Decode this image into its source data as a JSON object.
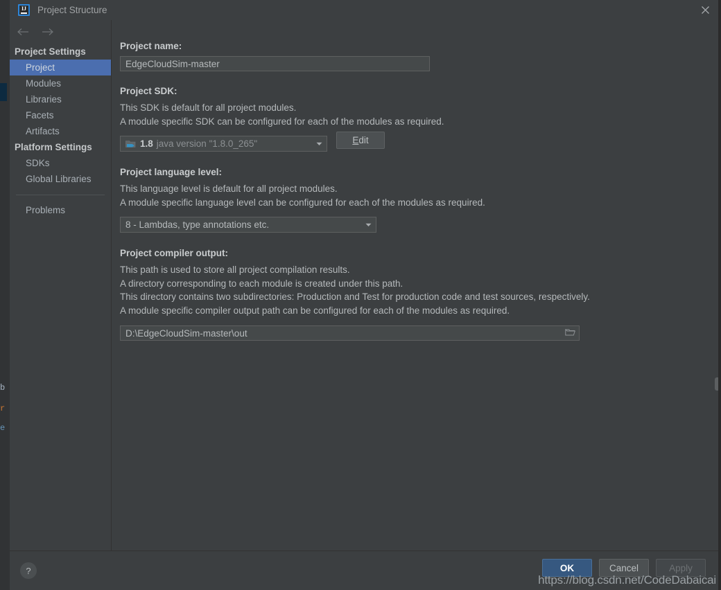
{
  "window": {
    "title": "Project Structure",
    "app_icon": "intellij-idea-icon",
    "close_icon": "close-icon"
  },
  "nav": {
    "back_icon": "arrow-left-icon",
    "forward_icon": "arrow-right-icon",
    "groups": [
      {
        "title": "Project Settings",
        "items": [
          {
            "label": "Project",
            "selected": true
          },
          {
            "label": "Modules",
            "selected": false
          },
          {
            "label": "Libraries",
            "selected": false
          },
          {
            "label": "Facets",
            "selected": false
          },
          {
            "label": "Artifacts",
            "selected": false
          }
        ]
      },
      {
        "title": "Platform Settings",
        "items": [
          {
            "label": "SDKs",
            "selected": false
          },
          {
            "label": "Global Libraries",
            "selected": false
          }
        ]
      }
    ],
    "problems": "Problems"
  },
  "main": {
    "project_name": {
      "label": "Project name:",
      "value": "EdgeCloudSim-master"
    },
    "project_sdk": {
      "label": "Project SDK:",
      "desc_line1": "This SDK is default for all project modules.",
      "desc_line2": "A module specific SDK can be configured for each of the modules as required.",
      "sdk_version": "1.8",
      "sdk_description": "java version \"1.8.0_265\"",
      "folder_icon": "java-sdk-folder-icon",
      "dropdown_icon": "chevron-down-icon",
      "edit_button": "Edit",
      "edit_button_mnemonic": "E",
      "edit_button_rest": "dit"
    },
    "language_level": {
      "label": "Project language level:",
      "desc_line1": "This language level is default for all project modules.",
      "desc_line2": "A module specific language level can be configured for each of the modules as required.",
      "value": "8 - Lambdas, type annotations etc.",
      "dropdown_icon": "chevron-down-icon"
    },
    "compiler_output": {
      "label": "Project compiler output:",
      "desc_line1": "This path is used to store all project compilation results.",
      "desc_line2": "A directory corresponding to each module is created under this path.",
      "desc_line3": "This directory contains two subdirectories: Production and Test for production code and test sources, respectively.",
      "desc_line4": "A module specific compiler output path can be configured for each of the modules as required.",
      "value": "D:\\EdgeCloudSim-master\\out",
      "browse_icon": "folder-browse-icon"
    }
  },
  "footer": {
    "help_label": "?",
    "help_icon": "help-icon",
    "ok": "OK",
    "cancel": "Cancel",
    "apply": "Apply"
  },
  "watermark": "https://blog.csdn.net/CodeDabaicai",
  "background_window": {
    "fragment1": "b",
    "fragment2": "r",
    "fragment3": "e"
  },
  "colors": {
    "dialog_bg": "#3c3f41",
    "selection_blue": "#4b6eaf",
    "ok_button_blue": "#365880",
    "field_bg": "#45494a",
    "text_primary": "#b5b9bb",
    "text_bold": "#c9ccce",
    "sdk_accent": "#4e97c9"
  }
}
